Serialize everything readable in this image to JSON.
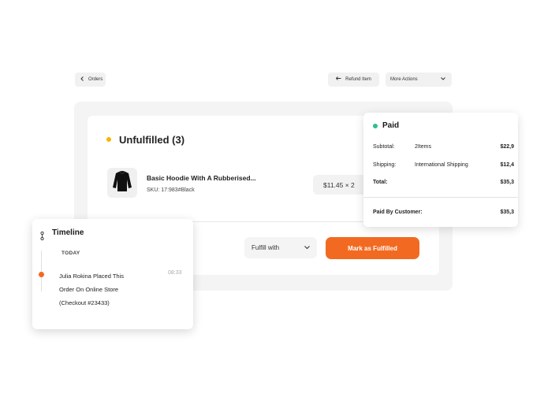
{
  "topbar": {
    "back_label": "Orders",
    "refund_label": "Refund Item",
    "more_label": "More Actions"
  },
  "order": {
    "status_title": "Unfulfilled (3)",
    "status_color": "#f7b500",
    "item": {
      "name": "Basic Hoodie With A Rubberised...",
      "sku": "SKU: 17:983#Black",
      "price_qty": "$11.45 × 2"
    },
    "fulfill_with_label": "Fulfill with",
    "mark_fulfilled_label": "Mark as Fulfilled",
    "accent_color": "#f26a21"
  },
  "payment": {
    "title": "Paid",
    "status_color": "#2fbf8f",
    "subtotal_label": "Subtotal:",
    "subtotal_items": "2Items",
    "subtotal_value": "$22,9",
    "shipping_label": "Shipping:",
    "shipping_method": "International Shipping",
    "shipping_value": "$12,4",
    "total_label": "Total:",
    "total_value": "$35,3",
    "paid_by_label": "Paid By Customer:",
    "paid_by_value": "$35,3"
  },
  "timeline": {
    "title": "Timeline",
    "day_label": "TODAY",
    "event_text": "Julia Rokina Placed This Order On Online Store (Checkout #23433)",
    "event_time": "08:33"
  }
}
